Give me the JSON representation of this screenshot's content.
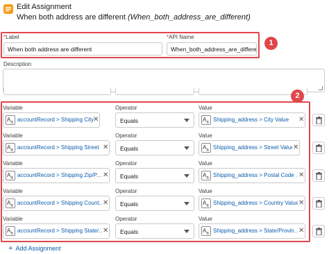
{
  "header": {
    "title": "Edit Assignment",
    "label_text": "When both address are different",
    "api_text": "(When_both_address_are_different)"
  },
  "fields": {
    "label": {
      "required": "*",
      "name": "Label",
      "value": "When both address are different"
    },
    "api_name": {
      "required": "*",
      "name": "API Name",
      "value": "When_both_address_are_different"
    },
    "description": {
      "name": "Description",
      "value": ""
    }
  },
  "badges": {
    "one": "1",
    "two": "2"
  },
  "columns": {
    "variable": "Variable",
    "operator": "Operator",
    "value": "Value"
  },
  "rows": [
    {
      "variable": "accountRecord > Shipping City",
      "operator": "Equals",
      "value": "Shipping_address > City Value"
    },
    {
      "variable": "accountRecord > Shipping Street",
      "operator": "Equals",
      "value": "Shipping_address > Street Value"
    },
    {
      "variable": "accountRecord > Shipping Zip/P...",
      "operator": "Equals",
      "value": "Shipping_address > Postal Code ..."
    },
    {
      "variable": "accountRecord > Shipping Count...",
      "operator": "Equals",
      "value": "Shipping_address > Country Value"
    },
    {
      "variable": "accountRecord > Shipping State/...",
      "operator": "Equals",
      "value": "Shipping_address > State/Provin..."
    }
  ],
  "add_button": "Add Assignment",
  "icons": {
    "header": "edit-assignment-icon",
    "type": "text-type-icon",
    "remove": "close-icon",
    "caret": "chevron-down-icon",
    "delete": "trash-icon",
    "add": "plus-icon"
  },
  "colors": {
    "accent": "#0b5cab",
    "highlight": "#e0464a",
    "header_icon": "#f59d1c"
  }
}
